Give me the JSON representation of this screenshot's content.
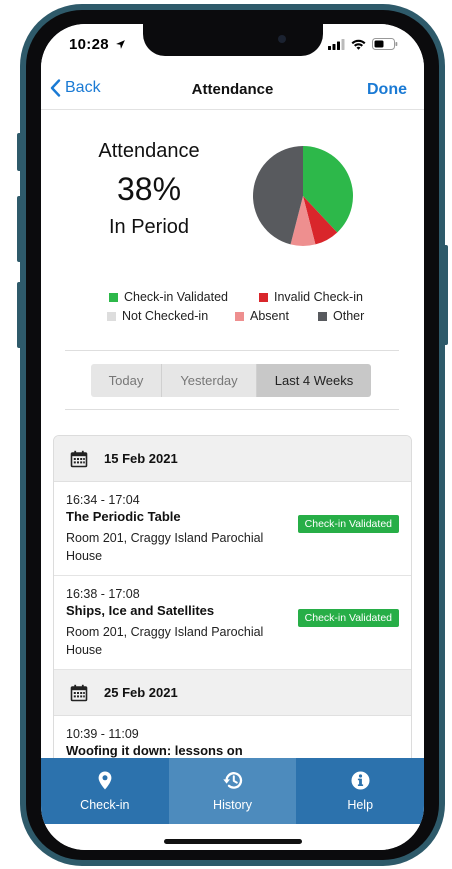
{
  "status": {
    "time": "10:28"
  },
  "nav": {
    "back_label": "Back",
    "title": "Attendance",
    "done_label": "Done"
  },
  "summary": {
    "label": "Attendance",
    "percent": "38%",
    "period": "In Period"
  },
  "chart_data": {
    "type": "pie",
    "categories": [
      "Check-in Validated",
      "Invalid Check-in",
      "Absent",
      "Other"
    ],
    "values": [
      38,
      8,
      8,
      46
    ],
    "colors": [
      "#2db84a",
      "#d9262b",
      "#ee8f8f",
      "#585a5e"
    ]
  },
  "legend": [
    {
      "label": "Check-in Validated",
      "color": "#2db84a"
    },
    {
      "label": "Invalid Check-in",
      "color": "#d9262b"
    },
    {
      "label": "Not Checked-in",
      "color": "#dddddd"
    },
    {
      "label": "Absent",
      "color": "#ee8f8f"
    },
    {
      "label": "Other",
      "color": "#585a5e"
    }
  ],
  "segments": [
    {
      "label": "Today",
      "active": false
    },
    {
      "label": "Yesterday",
      "active": false
    },
    {
      "label": "Last 4 Weeks",
      "active": true
    }
  ],
  "days": [
    {
      "date": "15 Feb 2021",
      "sessions": [
        {
          "time": "16:34 - 17:04",
          "title": "The Periodic Table",
          "room": "Room 201, Craggy Island Parochial House",
          "status": "Check-in Validated"
        },
        {
          "time": "16:38 - 17:08",
          "title": "Ships, Ice and Satellites",
          "room": "Room 201, Craggy Island Parochial House",
          "status": "Check-in Validated"
        }
      ]
    },
    {
      "date": "25 Feb 2021",
      "sessions": [
        {
          "time": "10:39 - 11:09",
          "title": "Woofing it down: lessons on",
          "room": "",
          "status": ""
        }
      ]
    }
  ],
  "tabs": [
    {
      "label": "Check-in",
      "icon": "location-pin-icon",
      "active": false
    },
    {
      "label": "History",
      "icon": "history-icon",
      "active": true
    },
    {
      "label": "Help",
      "icon": "info-icon",
      "active": false
    }
  ]
}
